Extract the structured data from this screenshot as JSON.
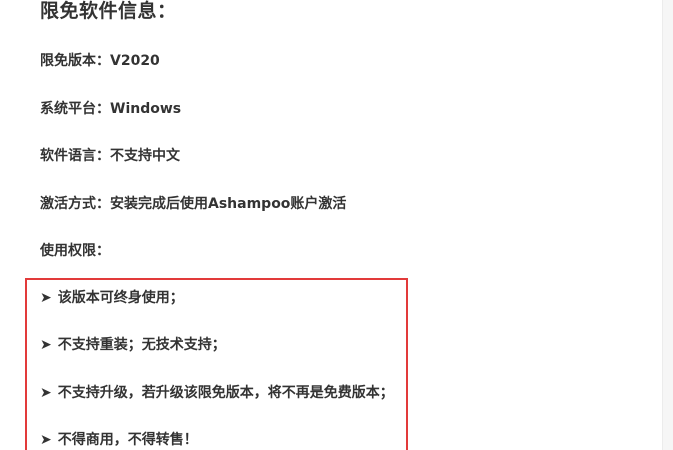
{
  "heading": "限免软件信息：",
  "info": [
    {
      "label": "限免版本：",
      "value": "V2020"
    },
    {
      "label": "系统平台：",
      "value": "Windows"
    },
    {
      "label": "软件语言：",
      "value": "不支持中文"
    },
    {
      "label": "激活方式：",
      "value": "安装完成后使用Ashampoo账户激活"
    },
    {
      "label": "使用权限：",
      "value": ""
    }
  ],
  "limits": {
    "border_color": "#e23a3a",
    "bullet": "➤",
    "items": [
      "该版本可终身使用；",
      "不支持重装；无技术支持；",
      "不支持升级，若升级该限免版本，将不再是免费版本；",
      "不得商用，不得转售！"
    ]
  }
}
